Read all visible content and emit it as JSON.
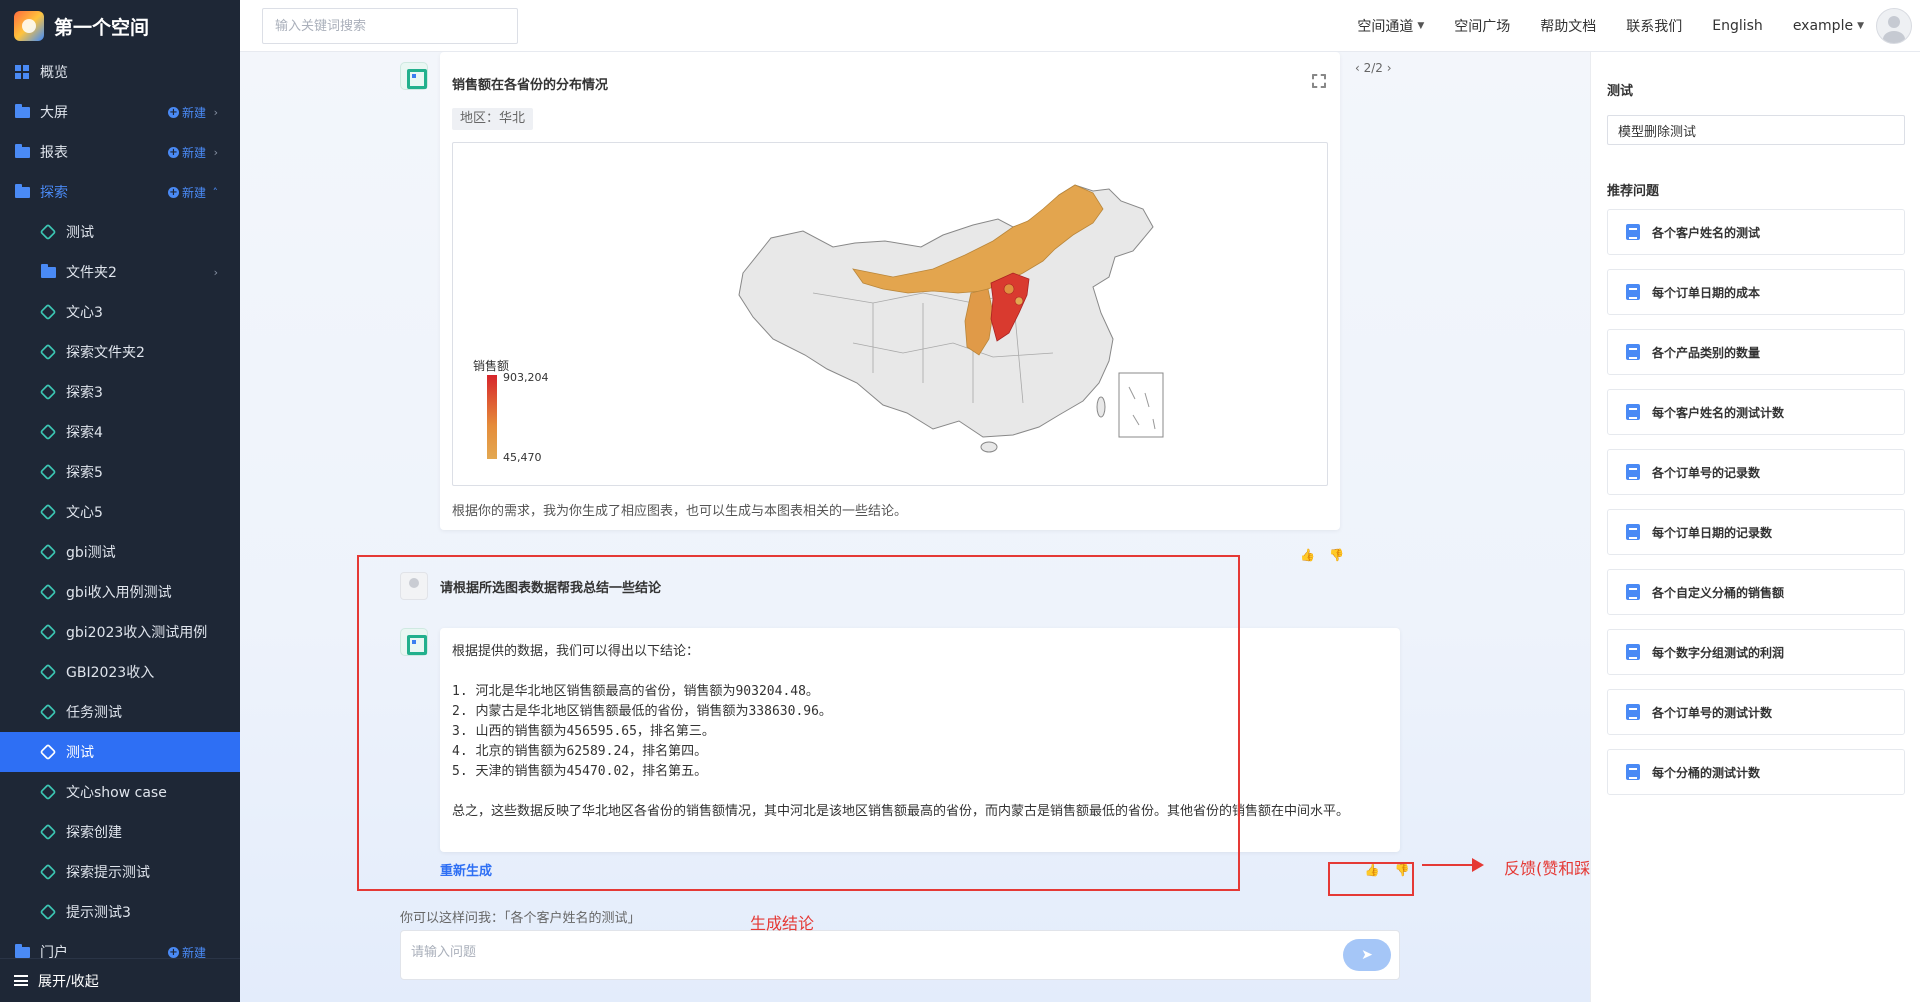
{
  "app": {
    "title": "第一个空间"
  },
  "sidebar": {
    "top_items": [
      {
        "label": "概览",
        "icon": "grid-icon"
      },
      {
        "label": "大屏",
        "icon": "folder-icon",
        "new_label": "新建"
      },
      {
        "label": "报表",
        "icon": "folder-icon",
        "new_label": "新建"
      },
      {
        "label": "探索",
        "icon": "folder-icon",
        "new_label": "新建"
      }
    ],
    "sub_items": [
      {
        "label": "测试"
      },
      {
        "label": "文件夹2",
        "type": "folder"
      },
      {
        "label": "文心3"
      },
      {
        "label": "探索文件夹2"
      },
      {
        "label": "探索3"
      },
      {
        "label": "探索4"
      },
      {
        "label": "探索5"
      },
      {
        "label": "文心5"
      },
      {
        "label": "gbi测试"
      },
      {
        "label": "gbi收入用例测试"
      },
      {
        "label": "gbi2023收入测试用例"
      },
      {
        "label": "GBI2023收入"
      },
      {
        "label": "任务测试"
      },
      {
        "label": "测试",
        "active": true
      },
      {
        "label": "文心show case"
      },
      {
        "label": "探索创建"
      },
      {
        "label": "探索提示测试"
      },
      {
        "label": "提示测试3"
      }
    ],
    "portal": {
      "label": "门户",
      "new_label": "新建"
    },
    "footer": "展开/收起"
  },
  "topbar": {
    "search_placeholder": "输入关键词搜索",
    "nav": [
      "空间通道",
      "空间广场",
      "帮助文档",
      "联系我们",
      "English",
      "example"
    ]
  },
  "chat": {
    "pager": "2/2",
    "chart_card": {
      "title": "销售额在各省份的分布情况",
      "region_tag": "地区：华北",
      "legend_title": "销售额",
      "legend_max": "903,204",
      "legend_min": "45,470",
      "note": "根据你的需求，我为你生成了相应图表，也可以生成与本图表相关的一些结论。"
    },
    "user_message": "请根据所选图表数据帮我总结一些结论",
    "answer": {
      "intro": "根据提供的数据，我们可以得出以下结论：",
      "points": [
        "1. 河北是华北地区销售额最高的省份，销售额为903204.48。",
        "2. 内蒙古是华北地区销售额最低的省份，销售额为338630.96。",
        "3. 山西的销售额为456595.65，排名第三。",
        "4. 北京的销售额为62589.24，排名第四。",
        "5. 天津的销售额为45470.02，排名第五。"
      ],
      "summary": "总之，这些数据反映了华北地区各省份的销售额情况，其中河北是该地区销售额最高的省份，而内蒙古是销售额最低的省份。其他省份的销售额在中间水平。",
      "regenerate": "重新生成"
    },
    "suggest": "你可以这样问我：「各个客户姓名的测试」",
    "input_placeholder": "请输入问题"
  },
  "annotations": {
    "feedback_label": "反馈(赞和踩)",
    "generate_label": "生成结论"
  },
  "right_panel": {
    "title": "测试",
    "model_input_value": "模型删除测试",
    "recommend_title": "推荐问题",
    "questions": [
      "各个客户姓名的测试",
      "每个订单日期的成本",
      "各个产品类别的数量",
      "每个客户姓名的测试计数",
      "各个订单号的记录数",
      "每个订单日期的记录数",
      "各个自定义分桶的销售额",
      "每个数字分组测试的利润",
      "各个订单号的测试计数",
      "每个分桶的测试计数"
    ]
  },
  "colors": {
    "sidebar_bg": "#1e2736",
    "accent": "#2e6ff4",
    "annotation_red": "#e53935",
    "map_high": "#d7262c",
    "map_low": "#e3a851"
  }
}
